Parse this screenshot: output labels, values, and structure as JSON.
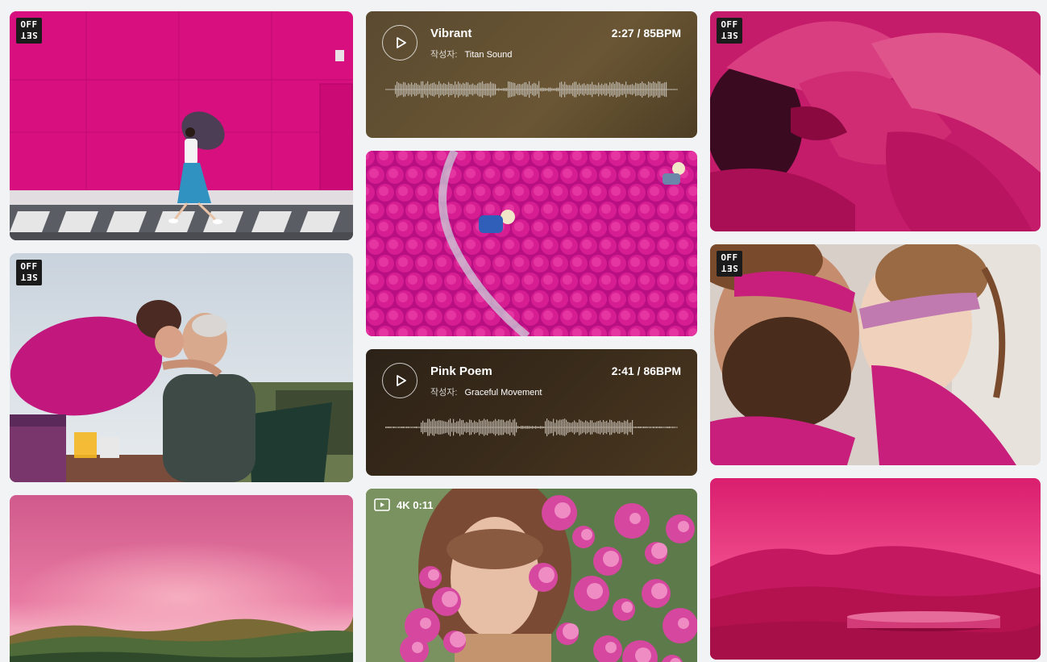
{
  "badges": {
    "offset_line1": "OFF",
    "offset_line2": "SET"
  },
  "audio_tracks": [
    {
      "title": "Vibrant",
      "by_label": "작성자:",
      "author": "Titan Sound",
      "duration_bpm": "2:27 / 85BPM"
    },
    {
      "title": "Pink Poem",
      "by_label": "작성자:",
      "author": "Graceful Movement",
      "duration_bpm": "2:41 / 86BPM"
    }
  ],
  "video": {
    "badge_text": "4K 0:11"
  },
  "icons": {
    "play": "play-icon",
    "video": "video-icon",
    "offset": "offset-badge"
  },
  "colors": {
    "page_bg": "#f2f3f5",
    "magenta": "#d4127e",
    "audio_brown": "#5a4a30",
    "audio_dark": "#2c2217"
  }
}
